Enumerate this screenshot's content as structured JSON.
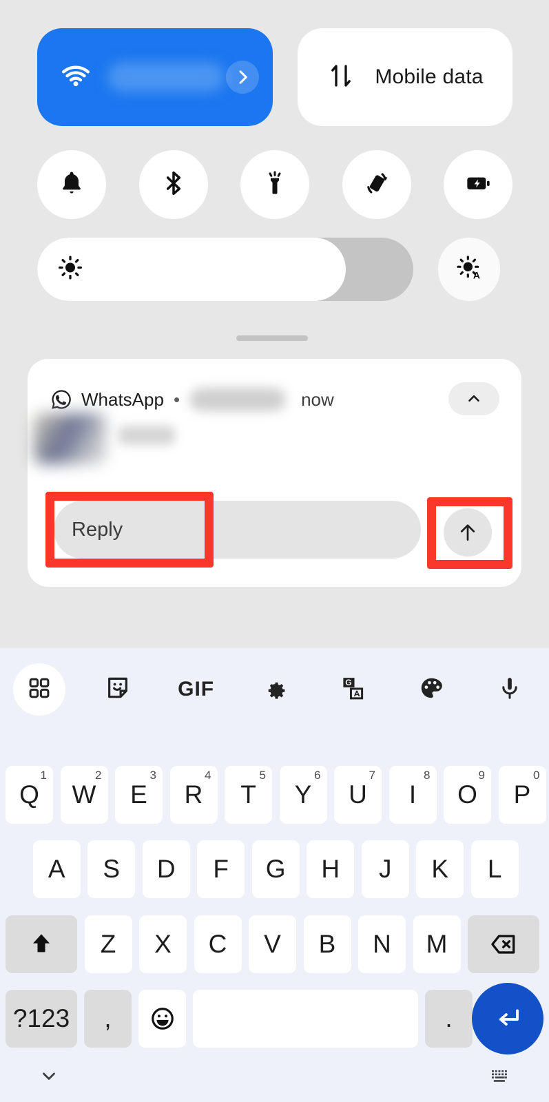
{
  "quick_settings": {
    "wifi_tile": {
      "icon": "wifi-icon",
      "label_blurred": true,
      "chevron": "chevron-right-icon",
      "color": "#1b76ef"
    },
    "mobile_tile": {
      "icon": "mobile-data-icon",
      "label": "Mobile data",
      "color": "#ffffff"
    },
    "toggles": [
      {
        "name": "ringer-toggle",
        "icon": "bell-icon"
      },
      {
        "name": "bluetooth-toggle",
        "icon": "bluetooth-icon"
      },
      {
        "name": "flashlight-toggle",
        "icon": "flashlight-icon"
      },
      {
        "name": "auto-rotate-toggle",
        "icon": "auto-rotate-icon"
      },
      {
        "name": "battery-saver-toggle",
        "icon": "battery-saver-icon"
      }
    ],
    "brightness": {
      "icon": "brightness-icon",
      "percent": 82,
      "auto_icon": "auto-brightness-icon"
    }
  },
  "notification": {
    "app_name": "WhatsApp",
    "separator": "•",
    "sender_blurred": true,
    "time": "now",
    "collapse_icon": "chevron-up-icon",
    "avatar_blurred": true,
    "message_blurred": true,
    "reply_placeholder": "Reply",
    "send_icon": "arrow-up-icon"
  },
  "annotations": {
    "color": "#f9372a",
    "boxes": [
      {
        "target": "reply-input"
      },
      {
        "target": "send-button"
      }
    ]
  },
  "keyboard": {
    "toolbar": [
      {
        "name": "apps-grid-button",
        "icon": "grid-icon",
        "active": true
      },
      {
        "name": "sticker-button",
        "icon": "sticker-icon",
        "active": false
      },
      {
        "name": "gif-button",
        "icon": "gif-icon",
        "label": "GIF",
        "active": false
      },
      {
        "name": "settings-button",
        "icon": "gear-icon",
        "active": false
      },
      {
        "name": "translate-button",
        "icon": "translate-icon",
        "active": false
      },
      {
        "name": "theme-button",
        "icon": "palette-icon",
        "active": false
      },
      {
        "name": "voice-input-button",
        "icon": "microphone-icon",
        "active": false
      }
    ],
    "row1": [
      {
        "label": "Q",
        "sup": "1"
      },
      {
        "label": "W",
        "sup": "2"
      },
      {
        "label": "E",
        "sup": "3"
      },
      {
        "label": "R",
        "sup": "4"
      },
      {
        "label": "T",
        "sup": "5"
      },
      {
        "label": "Y",
        "sup": "6"
      },
      {
        "label": "U",
        "sup": "7"
      },
      {
        "label": "I",
        "sup": "8"
      },
      {
        "label": "O",
        "sup": "9"
      },
      {
        "label": "P",
        "sup": "0"
      }
    ],
    "row2": [
      {
        "label": "A"
      },
      {
        "label": "S"
      },
      {
        "label": "D"
      },
      {
        "label": "F"
      },
      {
        "label": "G"
      },
      {
        "label": "H"
      },
      {
        "label": "J"
      },
      {
        "label": "K"
      },
      {
        "label": "L"
      }
    ],
    "row3": {
      "shift": {
        "name": "shift-key",
        "icon": "shift-arrow-icon"
      },
      "letters": [
        {
          "label": "Z"
        },
        {
          "label": "X"
        },
        {
          "label": "C"
        },
        {
          "label": "V"
        },
        {
          "label": "B"
        },
        {
          "label": "N"
        },
        {
          "label": "M"
        }
      ],
      "backspace": {
        "name": "backspace-key",
        "icon": "backspace-icon"
      }
    },
    "row4": {
      "symbols": {
        "label": "?123"
      },
      "comma": {
        "label": ","
      },
      "emoji": {
        "name": "emoji-key",
        "icon": "emoji-smiley-icon"
      },
      "space": {
        "label": ""
      },
      "period": {
        "label": "."
      },
      "enter": {
        "name": "enter-key",
        "icon": "return-arrow-icon",
        "color": "#1351c8"
      }
    },
    "nav": {
      "hide": {
        "name": "hide-keyboard-button",
        "icon": "chevron-down-icon"
      },
      "switcher": {
        "name": "keyboard-switcher-button",
        "icon": "keyboard-icon"
      }
    }
  }
}
